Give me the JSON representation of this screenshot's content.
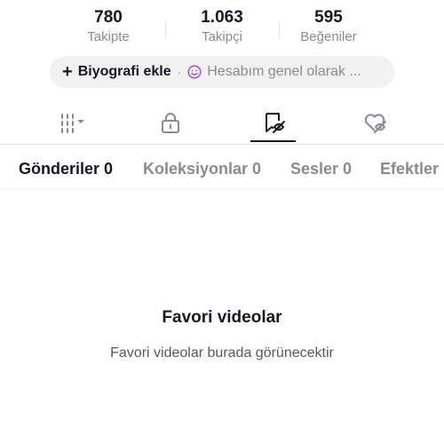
{
  "stats": [
    {
      "value": "780",
      "label": "Takipte"
    },
    {
      "value": "1.063",
      "label": "Takipçi"
    },
    {
      "value": "595",
      "label": "Beğeniler"
    }
  ],
  "bio": {
    "plus": "+",
    "add_label": "Biyografi ekle",
    "dot": "·",
    "smile_icon": "smile-icon",
    "hint": "Hesabım genel olarak ..."
  },
  "icon_tabs": [
    {
      "icon": "grid-dropdown-icon",
      "active": false
    },
    {
      "icon": "lock-icon",
      "active": false
    },
    {
      "icon": "bookmark-video-icon",
      "active": true
    },
    {
      "icon": "liked-heart-icon",
      "active": false
    }
  ],
  "sub_tabs": [
    {
      "label": "Gönderiler 0",
      "active": true
    },
    {
      "label": "Koleksiyonlar 0",
      "active": false
    },
    {
      "label": "Sesler 0",
      "active": false
    },
    {
      "label": "Efektler",
      "active": false
    }
  ],
  "empty_state": {
    "title": "Favori videolar",
    "description": "Favori videolar burada görünecektir"
  },
  "colors": {
    "text_primary": "#161823",
    "text_secondary": "#8a8b91",
    "pill_background": "#f1f1f2",
    "smile_accent": "#a34ee6"
  }
}
